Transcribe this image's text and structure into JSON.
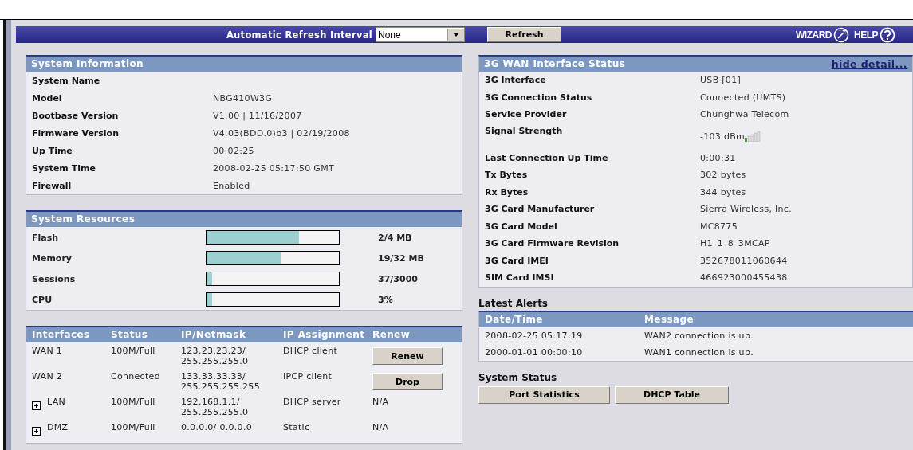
{
  "toolbar": {
    "refresh_label": "Automatic Refresh Interval",
    "refresh_select": "None",
    "refresh_button": "Refresh",
    "wizard": "WIZARD",
    "help": "HELP"
  },
  "system_information": {
    "title": "System Information",
    "rows": [
      {
        "label": "System Name",
        "value": ""
      },
      {
        "label": "Model",
        "value": "NBG410W3G"
      },
      {
        "label": "Bootbase Version",
        "value": "V1.00 | 11/16/2007"
      },
      {
        "label": "Firmware Version",
        "value": "V4.03(BDD.0)b3 | 02/19/2008"
      },
      {
        "label": "Up Time",
        "value": "00:02:25"
      },
      {
        "label": "System Time",
        "value": "2008-02-25 05:17:50 GMT"
      },
      {
        "label": "Firewall",
        "value": "Enabled"
      }
    ]
  },
  "system_resources": {
    "title": "System Resources",
    "rows": [
      {
        "label": "Flash",
        "level": 0.7,
        "reading": "2/4 MB"
      },
      {
        "label": "Memory",
        "level": 0.56,
        "reading": "19/32 MB"
      },
      {
        "label": "Sessions",
        "level": 0.04,
        "reading": "37/3000"
      },
      {
        "label": "CPU",
        "level": 0.04,
        "reading": "3%"
      }
    ]
  },
  "interfaces": {
    "columns": [
      "Interfaces",
      "Status",
      "IP/Netmask",
      "IP Assignment",
      "Renew"
    ],
    "rows": [
      {
        "name": "WAN 1",
        "expandable": false,
        "status": "100M/Full",
        "ip": [
          "123.23.23.23/",
          "255.255.255.0"
        ],
        "assignment": "DHCP client",
        "renew": {
          "kind": "button",
          "text": "Renew"
        }
      },
      {
        "name": "WAN 2",
        "expandable": false,
        "status": "Connected",
        "ip": [
          "133.33.33.33/",
          "255.255.255.255"
        ],
        "assignment": "IPCP client",
        "renew": {
          "kind": "button",
          "text": "Drop"
        }
      },
      {
        "name": "LAN",
        "expandable": true,
        "status": "100M/Full",
        "ip": [
          "192.168.1.1/",
          "255.255.255.0"
        ],
        "assignment": "DHCP server",
        "renew": {
          "kind": "text",
          "text": "N/A"
        }
      },
      {
        "name": "DMZ",
        "expandable": true,
        "status": "100M/Full",
        "ip": [
          "0.0.0.0/ 0.0.0.0"
        ],
        "assignment": "Static",
        "renew": {
          "kind": "text",
          "text": "N/A"
        }
      }
    ]
  },
  "wan_status": {
    "title": "3G WAN Interface Status",
    "link": "hide detail...",
    "rows": [
      {
        "label": "3G Interface",
        "value": "USB [01]"
      },
      {
        "label": "3G Connection Status",
        "value": "Connected (UMTS)"
      },
      {
        "label": "Service Provider",
        "value": "Chunghwa Telecom"
      },
      {
        "label": "Signal Strength",
        "value": "-103 dBm",
        "kind": "signal"
      },
      {
        "label": "Last Connection Up Time",
        "value": "0:00:31"
      },
      {
        "label": "Tx Bytes",
        "value": "302 bytes"
      },
      {
        "label": "Rx Bytes",
        "value": "344 bytes"
      },
      {
        "label": "3G Card Manufacturer",
        "value": "Sierra Wireless, Inc."
      },
      {
        "label": "3G Card Model",
        "value": "MC8775"
      },
      {
        "label": "3G Card Firmware Revision",
        "value": "H1_1_8_3MCAP"
      },
      {
        "label": "3G Card IMEI",
        "value": "352678011060644"
      },
      {
        "label": "SIM Card IMSI",
        "value": "466923000455438"
      }
    ]
  },
  "latest_alerts": {
    "title": "Latest Alerts",
    "columns": [
      "Date/Time",
      "Message"
    ],
    "rows": [
      {
        "time": "2008-02-25 05:17:19",
        "message": "WAN2 connection is up."
      },
      {
        "time": "2000-01-01 00:00:10",
        "message": "WAN1 connection is up."
      }
    ]
  },
  "system_status": {
    "title": "System Status",
    "buttons": [
      "Port Statistics",
      "DHCP Table"
    ]
  }
}
